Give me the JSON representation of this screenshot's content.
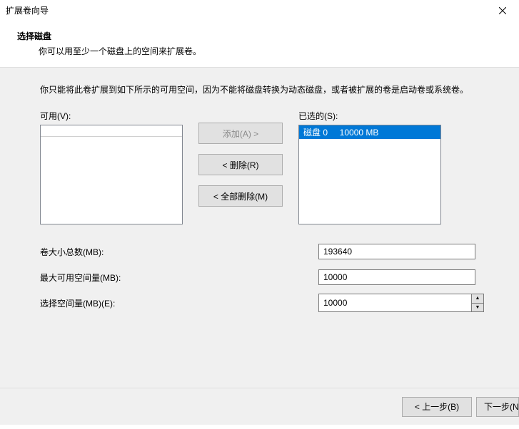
{
  "window": {
    "title": "扩展卷向导"
  },
  "header": {
    "title": "选择磁盘",
    "subtitle": "你可以用至少一个磁盘上的空间来扩展卷。"
  },
  "explain": "你只能将此卷扩展到如下所示的可用空间，因为不能将磁盘转换为动态磁盘，或者被扩展的卷是启动卷或系统卷。",
  "labels": {
    "available": "可用(V):",
    "selected": "已选的(S):"
  },
  "buttons": {
    "add": "添加(A) >",
    "remove": "< 删除(R)",
    "remove_all": "< 全部删除(M)",
    "back": "< 上一步(B)",
    "next": "下一步(N) >"
  },
  "available_items": [],
  "selected_items": [
    {
      "text": "磁盘 0     10000 MB",
      "selected": true
    }
  ],
  "form": {
    "total_label": "卷大小总数(MB):",
    "total_value": "193640",
    "max_label": "最大可用空间量(MB):",
    "max_value": "10000",
    "choose_label": "选择空间量(MB)(E):",
    "choose_value": "10000"
  }
}
